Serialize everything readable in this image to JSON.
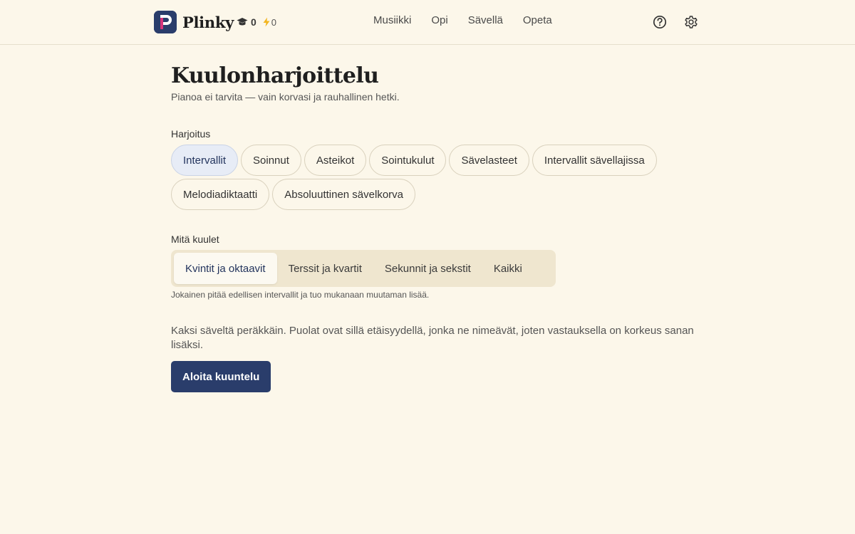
{
  "header": {
    "brand_name": "Plinky",
    "logo_letter": "P",
    "stats": {
      "xp": "0",
      "streak": "0"
    },
    "nav": [
      "Musiikki",
      "Opi",
      "Sävellä",
      "Opeta"
    ],
    "icons": {
      "stats_xp": "graduation-cap-icon",
      "stats_streak": "lightning-icon",
      "help": "question-circle-icon",
      "settings": "gear-icon"
    }
  },
  "main": {
    "title": "Kuulonharjoittelu",
    "subtitle": "Pianoa ei tarvita — vain korvasi ja rauhallinen hetki.",
    "exercise_label": "Harjoitus",
    "exercises": [
      "Intervallit",
      "Soinnut",
      "Asteikot",
      "Sointukulut",
      "Sävelasteet",
      "Intervallit sävellajissa",
      "Melodiadiktaatti",
      "Absoluuttinen sävelkorva"
    ],
    "selected_exercise": "Intervallit",
    "hear_label": "Mitä kuulet",
    "levels": [
      "Kvintit ja oktaavit",
      "Terssit ja kvartit",
      "Sekunnit ja sekstit",
      "Kaikki"
    ],
    "selected_level": "Kvintit ja oktaavit",
    "levels_note": "Jokainen pitää edellisen intervallit ja tuo mukanaan muutaman lisää.",
    "description": "Kaksi säveltä peräkkäin. Puolat ovat sillä etäisyydellä, jonka ne nimeävät, joten vastauksella on korkeus sanan lisäksi.",
    "start_button": "Aloita kuuntelu"
  },
  "colors": {
    "background": "#fcf7ea",
    "primary": "#2a3d6b",
    "logo_accent": "#d6337a",
    "chip_active": "#e7ecf6"
  }
}
